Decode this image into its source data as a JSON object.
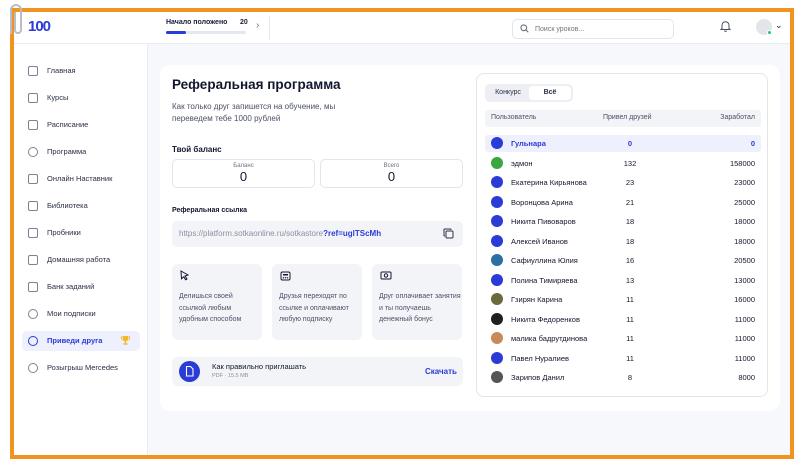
{
  "header": {
    "logo": "100",
    "progress": {
      "label": "Начало положено",
      "count": "20",
      "fraction": 0.25
    },
    "search": {
      "placeholder": "Поиск уроков..."
    }
  },
  "sidebar": {
    "items": [
      {
        "label": "Главная"
      },
      {
        "label": "Курсы"
      },
      {
        "label": "Расписание"
      },
      {
        "label": "Программа"
      },
      {
        "label": "Онлайн Наставник"
      },
      {
        "label": "Библиотека"
      },
      {
        "label": "Пробники"
      },
      {
        "label": "Домашняя работа"
      },
      {
        "label": "Банк заданий"
      },
      {
        "label": "Мои подписки"
      },
      {
        "label": "Приведи друга",
        "active": true
      },
      {
        "label": "Розыгрыш Mercedes"
      }
    ]
  },
  "referral": {
    "title": "Реферальная программа",
    "subtitle": "Как только друг запишется на обучение, мы переведем тебе 1000 рублей",
    "balance_title": "Твой баланс",
    "balance": {
      "label": "Баланс",
      "value": "0"
    },
    "total": {
      "label": "Всего",
      "value": "0"
    },
    "link_title": "Реферальная ссылка",
    "link_base": "https://platform.sotkaonline.ru/sotkastore",
    "link_param": "?ref=uglTScMh",
    "steps": [
      {
        "text": "Делишься своей ссылкой любым удобным способом"
      },
      {
        "text": "Друзья переходят по ссылке и оплачивают любую подписку"
      },
      {
        "text": "Друг оплачивает занятия и ты получаешь денежный бонус"
      }
    ],
    "file": {
      "name": "Как правильно приглашать",
      "meta": "PDF · 15.5 MB",
      "action": "Скачать"
    }
  },
  "leaderboard": {
    "tabs": [
      "Конкурс",
      "Всё"
    ],
    "active_tab": "Всё",
    "columns": [
      "Пользователь",
      "Привел друзей",
      "Заработал"
    ],
    "rows": [
      {
        "name": "Гульнара",
        "invited": "0",
        "earned": "0",
        "me": true,
        "color": "#2b3bd6"
      },
      {
        "name": "эдмон",
        "invited": "132",
        "earned": "158000",
        "color": "#3aa63f"
      },
      {
        "name": "Екатерина Кирьянова",
        "invited": "23",
        "earned": "23000",
        "color": "#2b3bd6"
      },
      {
        "name": "Воронцова Арина",
        "invited": "21",
        "earned": "25000",
        "color": "#2b3bd6"
      },
      {
        "name": "Никита Пивоваров",
        "invited": "18",
        "earned": "18000",
        "color": "#2b3bd6"
      },
      {
        "name": "Алексей Иванов",
        "invited": "18",
        "earned": "18000",
        "color": "#2b3bd6"
      },
      {
        "name": "Сафиуллина Юлия",
        "invited": "16",
        "earned": "20500",
        "color": "#2c6fa3"
      },
      {
        "name": "Полина Тимиряева",
        "invited": "13",
        "earned": "13000",
        "color": "#2b3bd6"
      },
      {
        "name": "Гзирян Карина",
        "invited": "11",
        "earned": "16000",
        "color": "#6b6a3a"
      },
      {
        "name": "Никита Федоренков",
        "invited": "11",
        "earned": "11000",
        "color": "#1f1f1f"
      },
      {
        "name": "малика бадрутдинова",
        "invited": "11",
        "earned": "11000",
        "color": "#c98a5a"
      },
      {
        "name": "Павел Нуралиев",
        "invited": "11",
        "earned": "11000",
        "color": "#2b3bd6"
      },
      {
        "name": "Зарипов Данил",
        "invited": "8",
        "earned": "8000",
        "color": "#555555"
      }
    ]
  },
  "colors": {
    "accent": "#2b3bd6",
    "frame": "#f0941f",
    "online": "#27c46b"
  }
}
